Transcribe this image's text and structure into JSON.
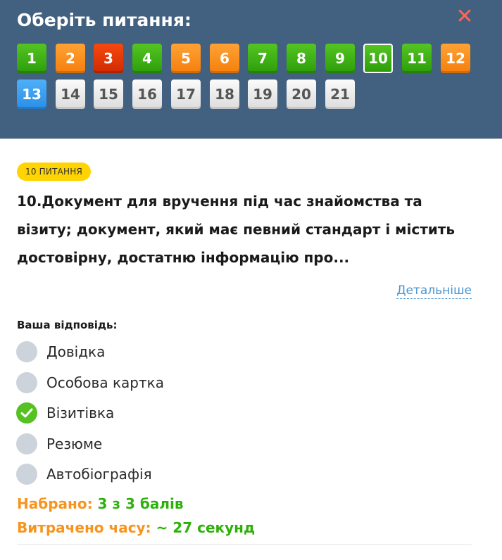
{
  "header": {
    "title": "Оберіть питання:",
    "close_symbol": "✕"
  },
  "questions": [
    {
      "label": "1",
      "status": "correct"
    },
    {
      "label": "2",
      "status": "partial"
    },
    {
      "label": "3",
      "status": "wrong"
    },
    {
      "label": "4",
      "status": "correct"
    },
    {
      "label": "5",
      "status": "partial"
    },
    {
      "label": "6",
      "status": "partial"
    },
    {
      "label": "7",
      "status": "correct"
    },
    {
      "label": "8",
      "status": "correct"
    },
    {
      "label": "9",
      "status": "correct"
    },
    {
      "label": "10",
      "status": "current"
    },
    {
      "label": "11",
      "status": "correct"
    },
    {
      "label": "12",
      "status": "partial"
    },
    {
      "label": "13",
      "status": "active"
    },
    {
      "label": "14",
      "status": "pending"
    },
    {
      "label": "15",
      "status": "pending"
    },
    {
      "label": "16",
      "status": "pending"
    },
    {
      "label": "17",
      "status": "pending"
    },
    {
      "label": "18",
      "status": "pending"
    },
    {
      "label": "19",
      "status": "pending"
    },
    {
      "label": "20",
      "status": "pending"
    },
    {
      "label": "21",
      "status": "pending"
    }
  ],
  "status_colors": {
    "correct": "#3cb015",
    "partial": "#f8901f",
    "wrong": "#e23a06",
    "active": "#3a9ef0",
    "pending": "#e6e6e6"
  },
  "question": {
    "badge": "10 ПИТАННЯ",
    "text": "10.Документ для вручення під час знайомства та візиту; документ, який має певний стандарт і містить достовірну, достатню інформацію про...",
    "details_link": "Детальніше"
  },
  "answer": {
    "label": "Ваша відповідь:",
    "options": [
      {
        "label": "Довідка",
        "selected": false
      },
      {
        "label": "Особова картка",
        "selected": false
      },
      {
        "label": "Візитівка",
        "selected": true
      },
      {
        "label": "Резюме",
        "selected": false
      },
      {
        "label": "Автобіографія",
        "selected": false
      }
    ]
  },
  "result": {
    "score_label": "Набрано:",
    "score_value": "3 з 3 балів",
    "time_label": "Витрачено часу:",
    "time_value": "~ 27 секунд"
  }
}
